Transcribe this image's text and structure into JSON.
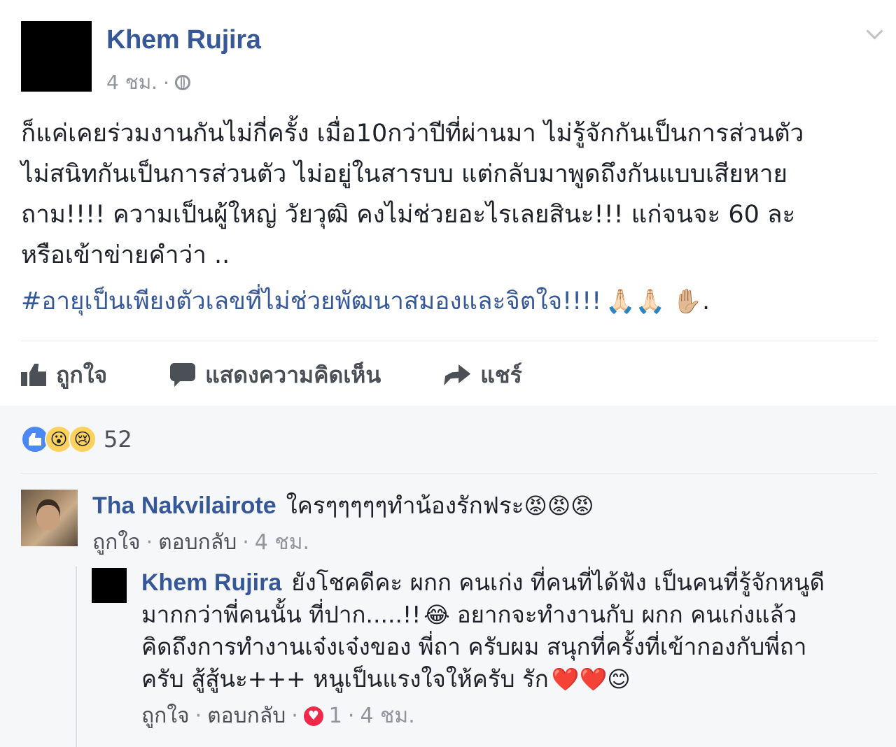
{
  "post": {
    "author": "Khem Rujira",
    "time": "4 ชม.",
    "meta_sep": "·",
    "lines": [
      "ก็แค่เคยร่วมงานกันไม่กี่ครั้ง เมื่อ10กว่าปีที่ผ่านมา ไม่รู้จักกันเป็นการส่วนตัว",
      "ไม่สนิทกันเป็นการส่วนตัว ไม่อยู่ในสารบบ แต่กลับมาพูดถึงกันแบบเสียหาย",
      "ถาม!!!! ความเป็นผู้ใหญ่ วัยวุฒิ คงไม่ช่วยอะไรเลยสินะ!!! แก่จนจะ 60 ละ",
      "หรือเข้าข่ายคำว่า .."
    ],
    "hashtag": "#อายุเป็นเพียงตัวเลขที่ไม่ช่วยพัฒนาสมองและจิตใจ!!!!",
    "hashtag_emoji": "🙏🏻🙏🏻 ✋🏼",
    "hashtag_tail": "."
  },
  "actions": {
    "like": "ถูกใจ",
    "comment": "แสดงความคิดเห็น",
    "share": "แชร์"
  },
  "reactions": {
    "icons": [
      "like-icon",
      "wow-icon",
      "sad-icon"
    ],
    "wow": "😮",
    "sad": "😢",
    "count": "52"
  },
  "comment": {
    "name": "Tha Nakvilairote",
    "text": "ใครๆๆๆๆๆทำน้องรักฟระ",
    "emoji": "😡😡😡",
    "like": "ถูกใจ",
    "reply": "ตอบกลับ",
    "time": "4 ชม.",
    "sep": "·"
  },
  "reply": {
    "name": "Khem Rujira",
    "line1": "ยังโชคดีคะ ผกก คนเก่ง ที่คนที่ได้ฟัง เป็นคนที่รู้จักหนูดี",
    "line2": "มากกว่าพี่คนนั้น ที่ปาก.....!!",
    "line2_emoji": "😂",
    "line2_tail": "อยากจะทำงานกับ ผกก คนเก่งแล้ว",
    "line3": "คิดถึงการทำงานเจ๋งเจ๋งของ พี่ถา ครับผม สนุกที่ครั้งที่เข้ากองกับพี่ถา",
    "line4": "ครับ สู้สู้นะ+++ หนูเป็นแรงใจให้ครับ รัก",
    "line4_emoji": "❤️❤️😊",
    "like": "ถูกใจ",
    "reply": "ตอบกลับ",
    "reaction_count": "1",
    "time": "4 ชม.",
    "sep": "·"
  }
}
